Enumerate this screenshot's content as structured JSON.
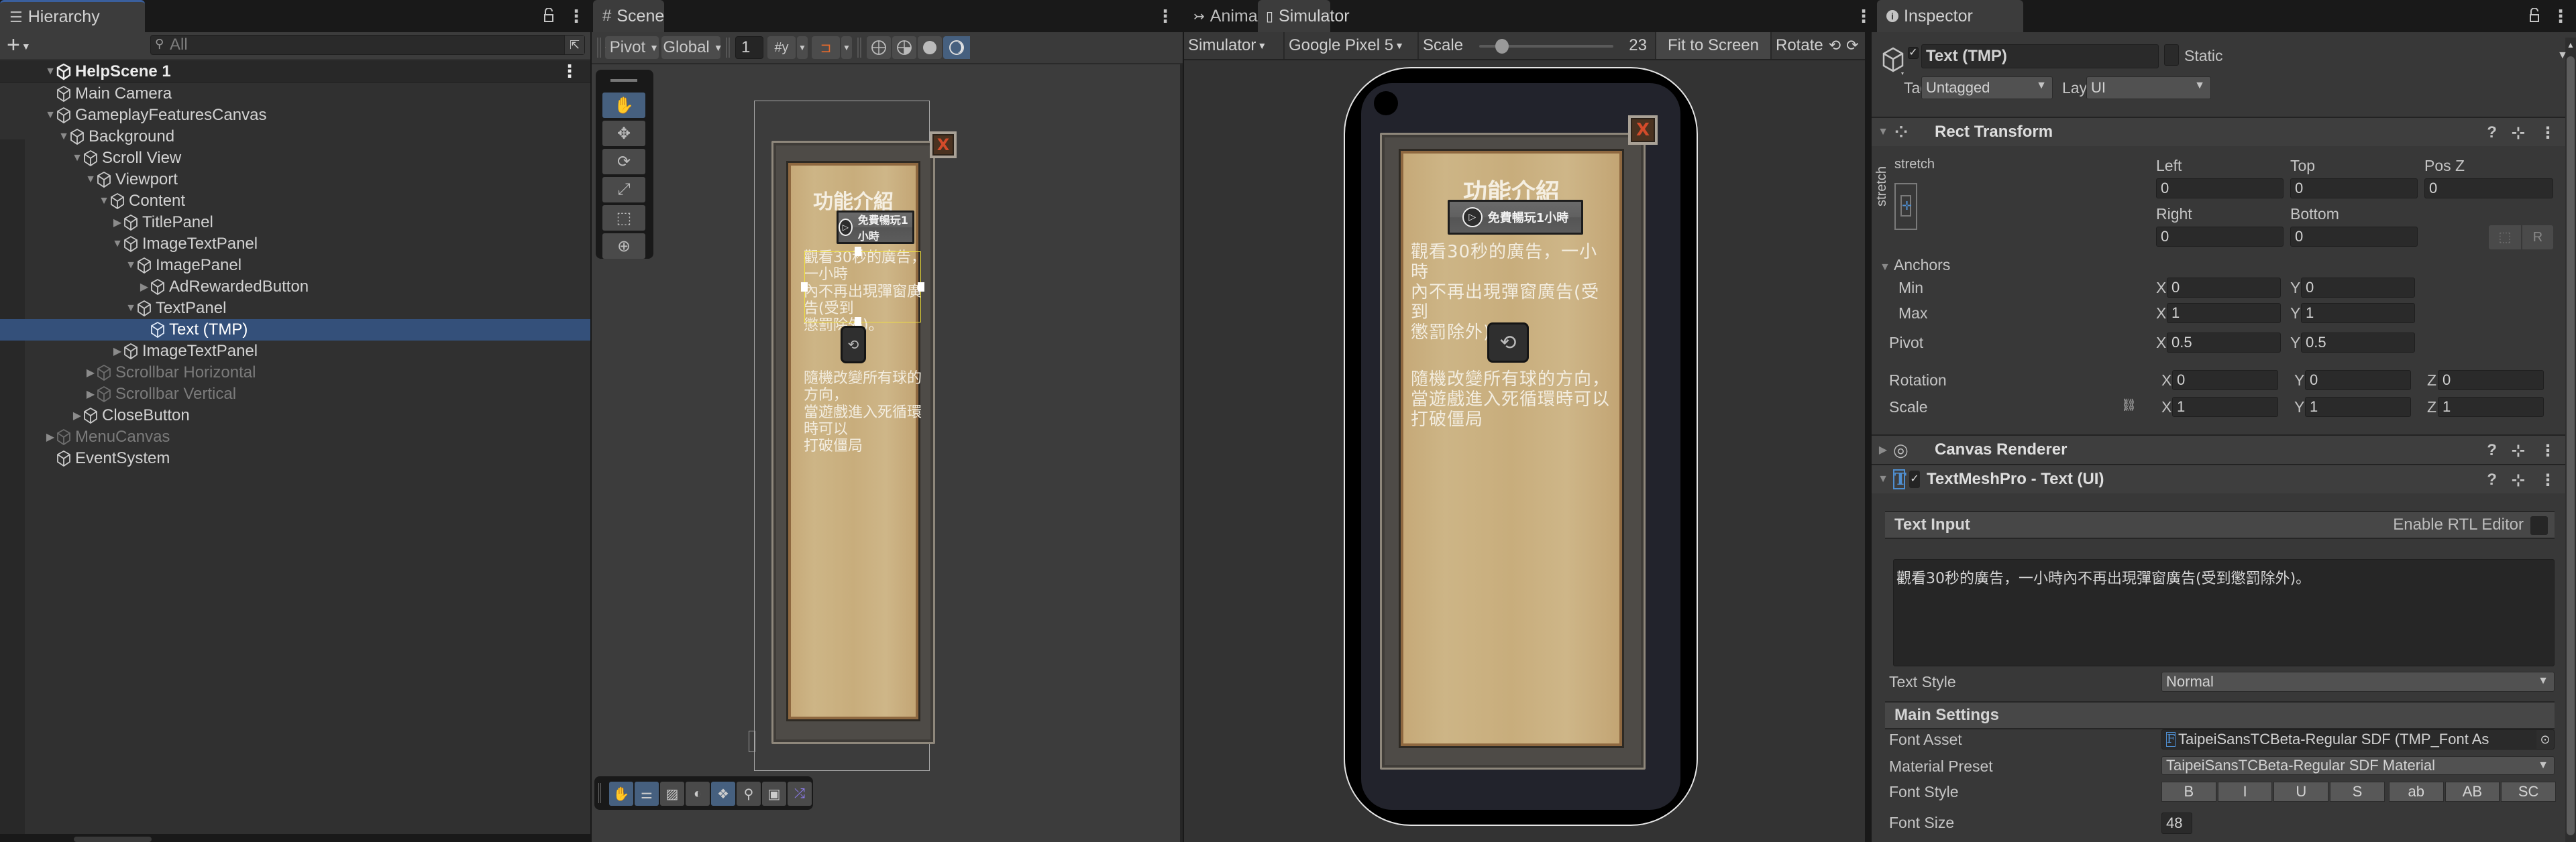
{
  "hierarchy": {
    "tab_label": "Hierarchy",
    "search_placeholder": "All",
    "scene_name": "HelpScene 1",
    "items": [
      {
        "label": "Main Camera",
        "depth": 1,
        "expand": "none",
        "dim": false
      },
      {
        "label": "GameplayFeaturesCanvas",
        "depth": 1,
        "expand": "open",
        "dim": false
      },
      {
        "label": "Background",
        "depth": 2,
        "expand": "open",
        "dim": false
      },
      {
        "label": "Scroll View",
        "depth": 3,
        "expand": "open",
        "dim": false
      },
      {
        "label": "Viewport",
        "depth": 4,
        "expand": "open",
        "dim": false
      },
      {
        "label": "Content",
        "depth": 5,
        "expand": "open",
        "dim": false
      },
      {
        "label": "TitlePanel",
        "depth": 6,
        "expand": "closed",
        "dim": false
      },
      {
        "label": "ImageTextPanel",
        "depth": 6,
        "expand": "open",
        "dim": false
      },
      {
        "label": "ImagePanel",
        "depth": 7,
        "expand": "open",
        "dim": false
      },
      {
        "label": "AdRewardedButton",
        "depth": 8,
        "expand": "closed",
        "dim": false
      },
      {
        "label": "TextPanel",
        "depth": 7,
        "expand": "open",
        "dim": false
      },
      {
        "label": "Text (TMP)",
        "depth": 8,
        "expand": "none",
        "dim": false,
        "selected": true
      },
      {
        "label": "ImageTextPanel",
        "depth": 6,
        "expand": "closed",
        "dim": false
      },
      {
        "label": "Scrollbar Horizontal",
        "depth": 4,
        "expand": "closed",
        "dim": true
      },
      {
        "label": "Scrollbar Vertical",
        "depth": 4,
        "expand": "closed",
        "dim": true
      },
      {
        "label": "CloseButton",
        "depth": 3,
        "expand": "closed",
        "dim": false
      },
      {
        "label": "MenuCanvas",
        "depth": 1,
        "expand": "closed",
        "dim": true
      },
      {
        "label": "EventSystem",
        "depth": 1,
        "expand": "none",
        "dim": false
      }
    ]
  },
  "scene": {
    "tab_label": "Scene",
    "pivot_label": "Pivot",
    "global_label": "Global",
    "grid_value": "1",
    "tools": [
      "hand-tool",
      "move-tool",
      "rotate-tool",
      "scale-tool",
      "rect-tool",
      "transform-tool"
    ],
    "overlay_tools": [
      "view-tool",
      "draw-modes",
      "grid-toggle",
      "lighting",
      "gizmos",
      "search",
      "camera",
      "shuffle"
    ]
  },
  "game_ui": {
    "title": "功能介紹",
    "ad_button_label": "免費暢玩1小時",
    "ad_text": "觀看30秒的廣告，一小時內不再出現彈窗廣告(受到懲罰除外)。",
    "ad_text_lines": [
      "觀看30秒的廣告，一小時",
      "內不再出現彈窗廣告(受到",
      "懲罰除外)。"
    ],
    "feature_text_lines": [
      "隨機改變所有球的方向，",
      "當遊戲進入死循環時可以",
      "打破僵局"
    ],
    "close_glyph": "X"
  },
  "tabs2": {
    "animator_label": "Animator",
    "simulator_label": "Simulator"
  },
  "simulator": {
    "mode": "Simulator",
    "device": "Google Pixel 5",
    "scale_label": "Scale",
    "scale_value": "23",
    "scale_fraction": 0.17,
    "fit_label": "Fit to Screen",
    "rotate_label": "Rotate"
  },
  "inspector": {
    "tab_label": "Inspector",
    "object_name": "Text (TMP)",
    "active": true,
    "static_label": "Static",
    "tag_label": "Tag",
    "tag_value": "Untagged",
    "layer_label": "Layer",
    "layer_value": "UI",
    "rect_transform": {
      "title": "Rect Transform",
      "anchor_preset_top": "stretch",
      "anchor_preset_side": "stretch",
      "left_label": "Left",
      "left": "0",
      "top_label": "Top",
      "top": "0",
      "posz_label": "Pos Z",
      "posz": "0",
      "right_label": "Right",
      "right": "0",
      "bottom_label": "Bottom",
      "bottom": "0",
      "raw_btn": "R",
      "anchors_label": "Anchors",
      "min_label": "Min",
      "min_x": "0",
      "min_y": "0",
      "max_label": "Max",
      "max_x": "1",
      "max_y": "1",
      "pivot_label": "Pivot",
      "pivot_x": "0.5",
      "pivot_y": "0.5",
      "rotation_label": "Rotation",
      "rot_x": "0",
      "rot_y": "0",
      "rot_z": "0",
      "scale_label": "Scale",
      "scale_x": "1",
      "scale_y": "1",
      "scale_z": "1",
      "x": "X",
      "y": "Y",
      "z": "Z"
    },
    "canvas_renderer": {
      "title": "Canvas Renderer"
    },
    "tmp": {
      "title": "TextMeshPro - Text (UI)",
      "enabled": true,
      "text_input_label": "Text Input",
      "rtl_label": "Enable RTL Editor",
      "text_value": "觀看30秒的廣告，一小時內不再出現彈窗廣告(受到懲罰除外)。",
      "text_style_label": "Text Style",
      "text_style_value": "Normal",
      "main_settings_label": "Main Settings",
      "font_asset_label": "Font Asset",
      "font_asset_value": "TaipeiSansTCBeta-Regular SDF (TMP_Font As",
      "material_preset_label": "Material Preset",
      "material_preset_value": "TaipeiSansTCBeta-Regular SDF Material",
      "font_style_label": "Font Style",
      "font_style_buttons": [
        "B",
        "I",
        "U",
        "S",
        "ab",
        "AB",
        "SC"
      ],
      "font_size_label": "Font Size",
      "font_size_value": "48"
    }
  },
  "colors": {
    "selection": "#34507a",
    "accent_blue": "#46607f",
    "paper": "#c8ad7c",
    "rect_gizmo": "#f0e040"
  }
}
